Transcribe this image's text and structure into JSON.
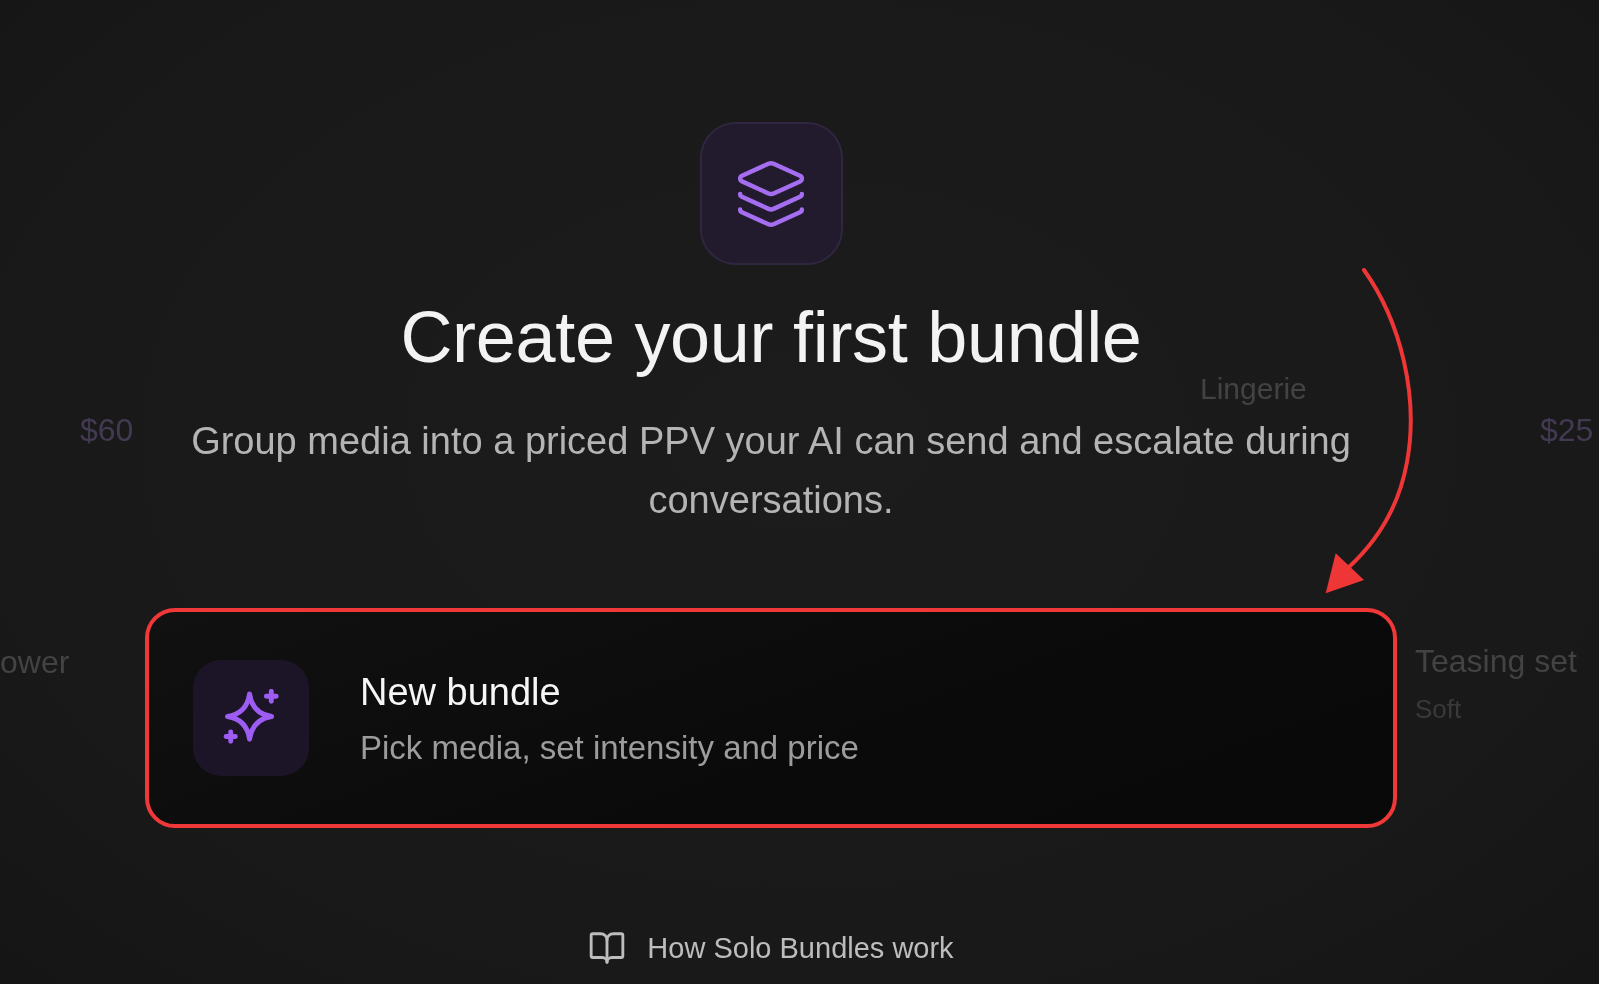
{
  "hero": {
    "title": "Create your first bundle",
    "description": "Group media into a priced PPV your AI can send and escalate during conversations."
  },
  "actions": [
    {
      "title": "New bundle",
      "description": "Pick media, set intensity and price",
      "highlighted": true
    }
  ],
  "help_link": {
    "label": "How Solo Bundles work"
  },
  "background_items": [
    {
      "kind": "price",
      "text": "$60"
    },
    {
      "kind": "title",
      "text": "Lingerie"
    },
    {
      "kind": "price",
      "text": "$25"
    },
    {
      "kind": "title",
      "text": "ower"
    },
    {
      "kind": "title",
      "text": "Teasing set"
    },
    {
      "kind": "tag",
      "text": "Soft"
    }
  ]
}
